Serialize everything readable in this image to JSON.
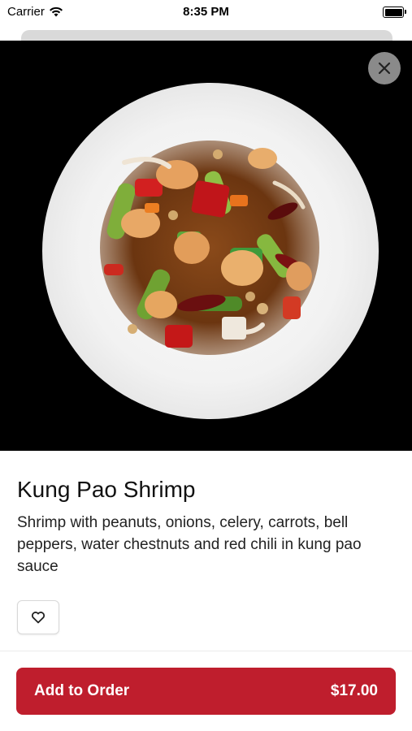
{
  "status_bar": {
    "carrier": "Carrier",
    "time": "8:35 PM"
  },
  "item": {
    "name": "Kung Pao Shrimp",
    "description": "Shrimp with peanuts, onions, celery, carrots, bell peppers, water chestnuts and red chili in kung pao sauce",
    "price": "$17.00"
  },
  "actions": {
    "add_label": "Add to Order"
  },
  "icons": {
    "close": "close-icon",
    "favorite": "heart-outline-icon",
    "wifi": "wifi-icon",
    "battery": "battery-icon"
  },
  "colors": {
    "accent": "#bf1e2d",
    "hero_bg": "#000000"
  }
}
